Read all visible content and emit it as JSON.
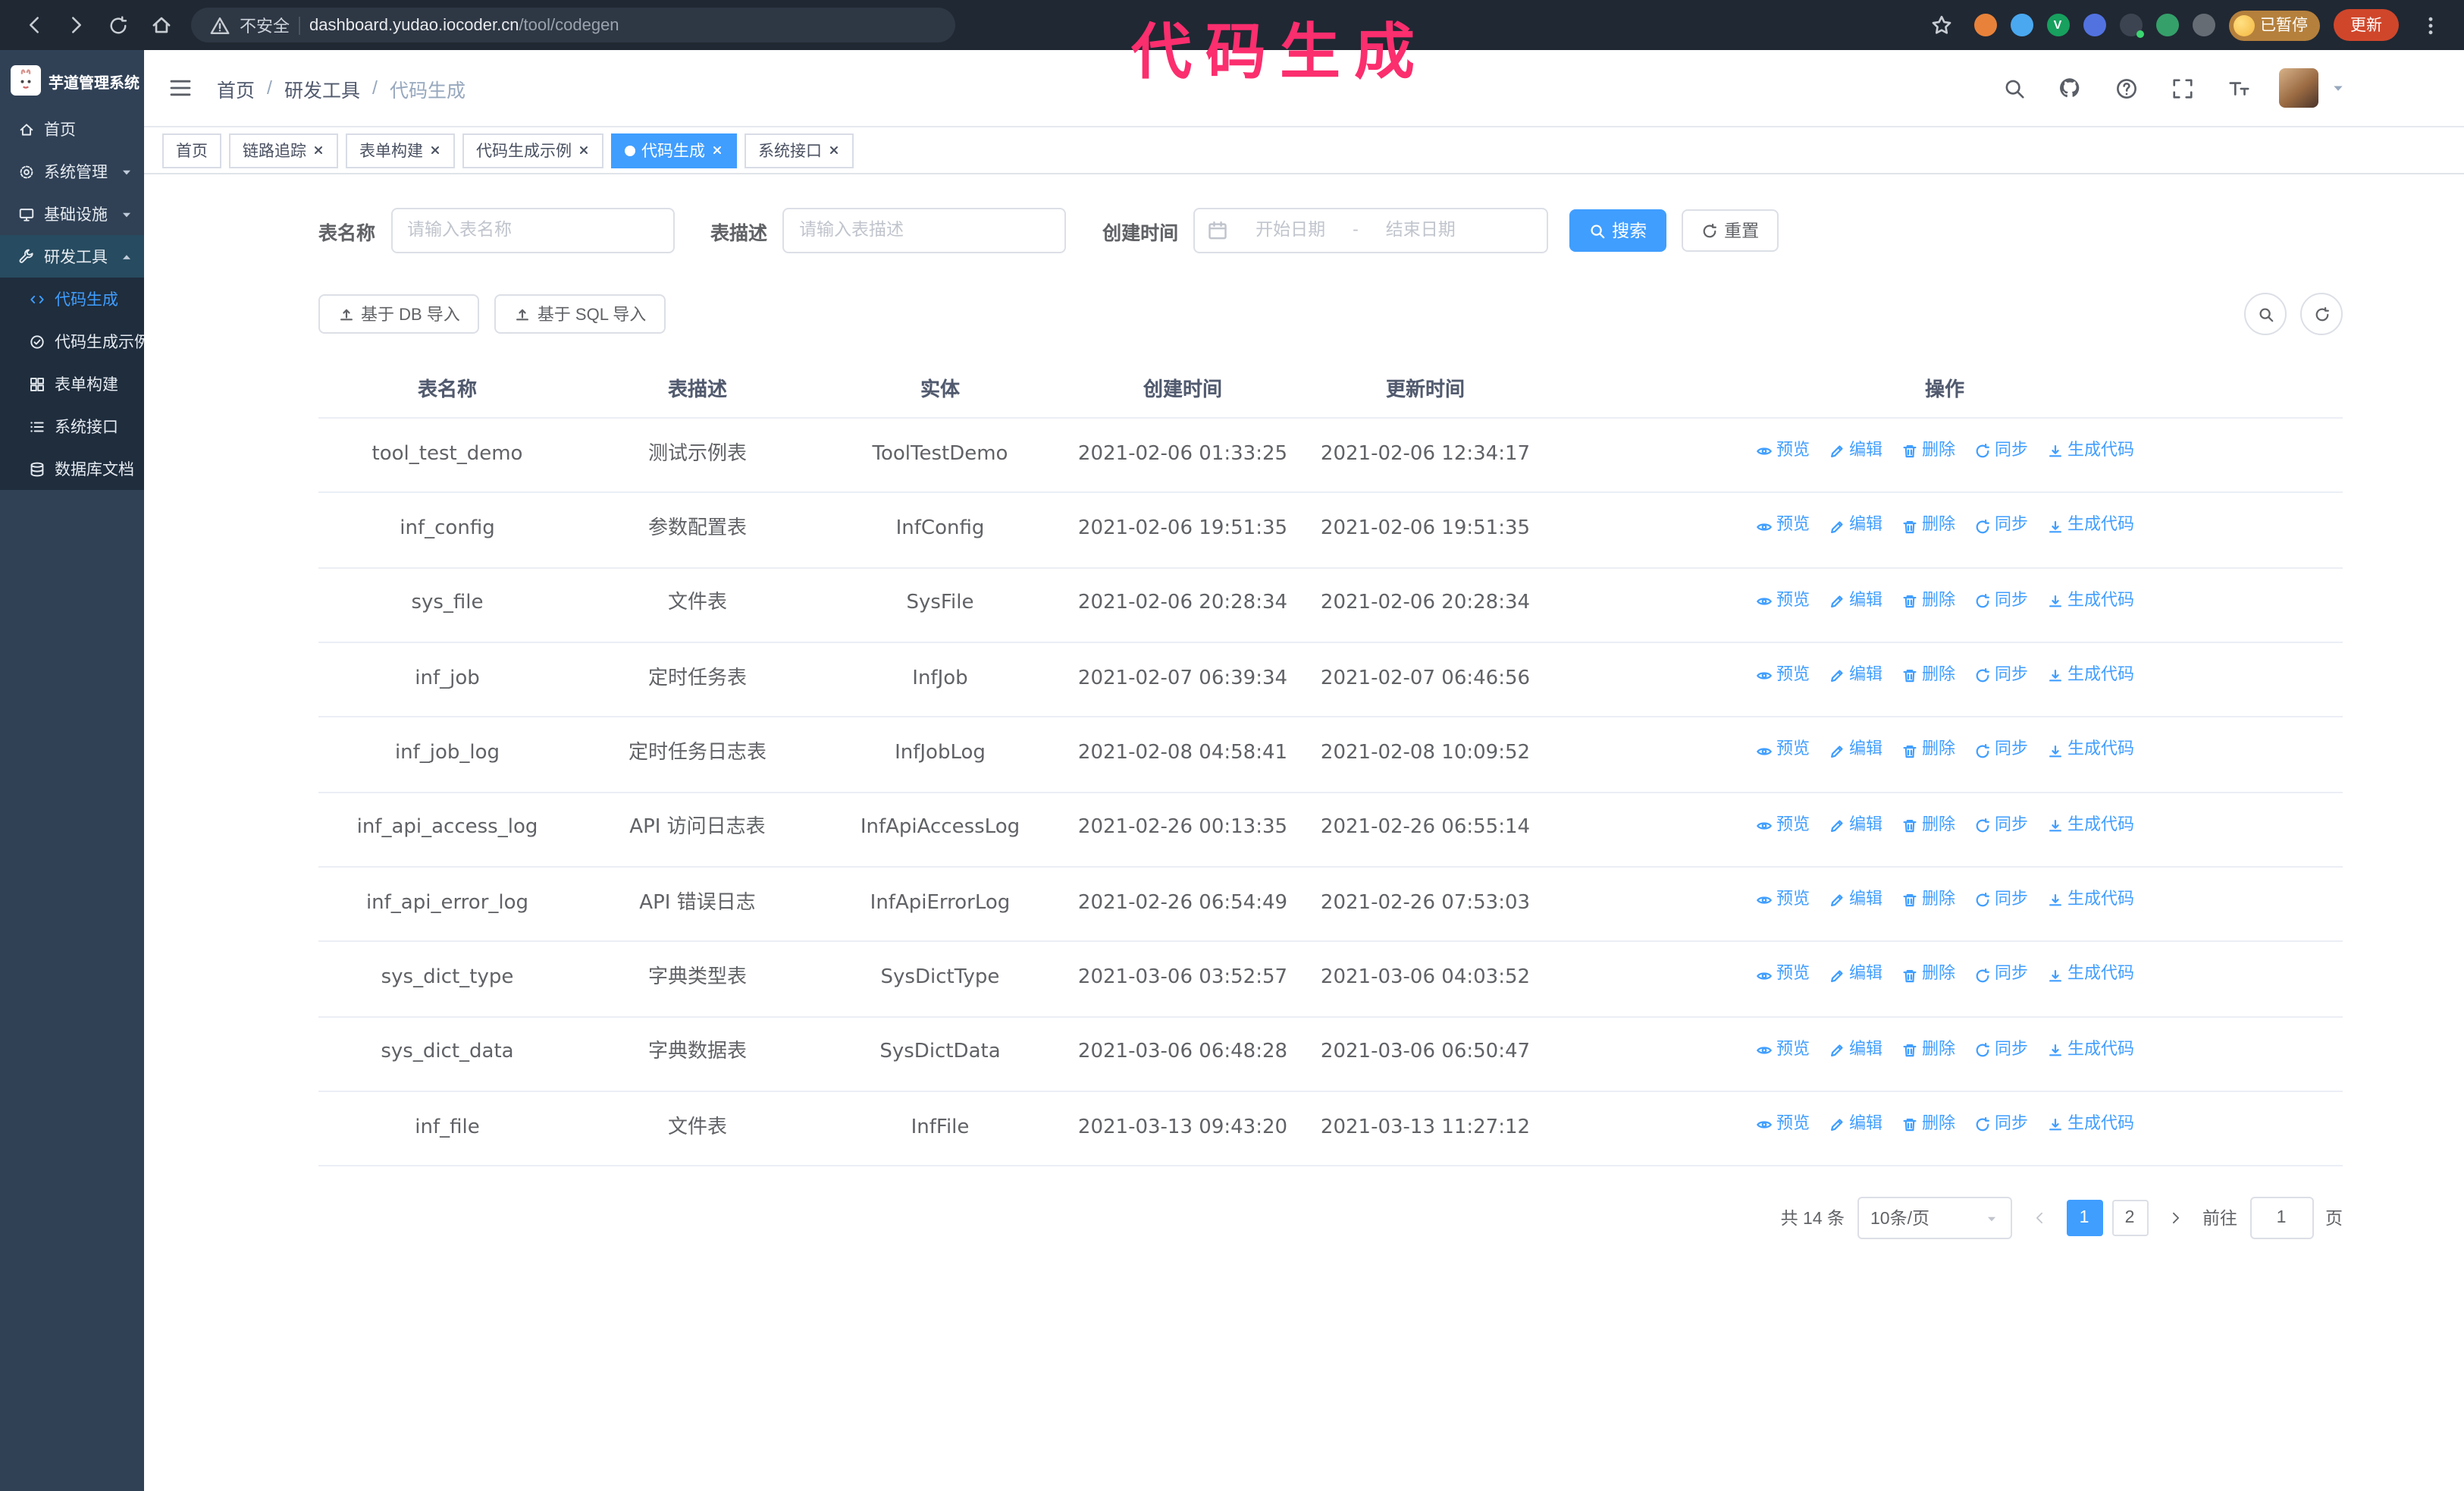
{
  "colors": {
    "accent": "#409eff",
    "sidebar_bg": "#304156",
    "submenu_bg": "#1f2d3d",
    "annotation": "#fb2e6e",
    "chrome_bg": "#202833"
  },
  "annotation": "代码生成",
  "browser": {
    "security_label": "不安全",
    "url_host": "dashboard.yudao.iocoder.cn",
    "url_path": "/tool/codegen",
    "paused_badge": "已暂停",
    "update_button": "更新"
  },
  "sidebar": {
    "logo_title": "芋道管理系统",
    "items": [
      {
        "id": "home",
        "icon": "home",
        "label": "首页"
      },
      {
        "id": "system",
        "icon": "gear",
        "label": "系统管理",
        "chevron": "down"
      },
      {
        "id": "infra",
        "icon": "monitor",
        "label": "基础设施",
        "chevron": "down"
      },
      {
        "id": "devtools",
        "icon": "tool",
        "label": "研发工具",
        "chevron": "up",
        "expanded": true,
        "children": [
          {
            "id": "codegen",
            "icon": "code",
            "label": "代码生成",
            "active": true
          },
          {
            "id": "codegen-demo",
            "icon": "badge",
            "label": "代码生成示例"
          },
          {
            "id": "form-builder",
            "icon": "grid",
            "label": "表单构建"
          },
          {
            "id": "api",
            "icon": "api",
            "label": "系统接口"
          },
          {
            "id": "db-doc",
            "icon": "db",
            "label": "数据库文档"
          }
        ]
      }
    ]
  },
  "header": {
    "breadcrumb": [
      "首页",
      "研发工具",
      "代码生成"
    ]
  },
  "tabs": [
    {
      "label": "首页",
      "closable": false,
      "active": false
    },
    {
      "label": "链路追踪",
      "closable": true,
      "active": false
    },
    {
      "label": "表单构建",
      "closable": true,
      "active": false
    },
    {
      "label": "代码生成示例",
      "closable": true,
      "active": false
    },
    {
      "label": "代码生成",
      "closable": true,
      "active": true
    },
    {
      "label": "系统接口",
      "closable": true,
      "active": false
    }
  ],
  "filters": {
    "table_name_label": "表名称",
    "table_name_placeholder": "请输入表名称",
    "table_desc_label": "表描述",
    "table_desc_placeholder": "请输入表描述",
    "create_time_label": "创建时间",
    "date_start_placeholder": "开始日期",
    "date_separator": "-",
    "date_end_placeholder": "结束日期",
    "search_button": "搜索",
    "reset_button": "重置"
  },
  "toolbar": {
    "import_db": "基于 DB 导入",
    "import_sql": "基于 SQL 导入"
  },
  "table": {
    "columns": [
      "表名称",
      "表描述",
      "实体",
      "创建时间",
      "更新时间",
      "操作"
    ],
    "actions": [
      "预览",
      "编辑",
      "删除",
      "同步",
      "生成代码"
    ],
    "rows": [
      {
        "name": "tool_test_demo",
        "desc": "测试示例表",
        "entity": "ToolTestDemo",
        "created": "2021-02-06 01:33:25",
        "updated": "2021-02-06 12:34:17"
      },
      {
        "name": "inf_config",
        "desc": "参数配置表",
        "entity": "InfConfig",
        "created": "2021-02-06 19:51:35",
        "updated": "2021-02-06 19:51:35"
      },
      {
        "name": "sys_file",
        "desc": "文件表",
        "entity": "SysFile",
        "created": "2021-02-06 20:28:34",
        "updated": "2021-02-06 20:28:34"
      },
      {
        "name": "inf_job",
        "desc": "定时任务表",
        "entity": "InfJob",
        "created": "2021-02-07 06:39:34",
        "updated": "2021-02-07 06:46:56"
      },
      {
        "name": "inf_job_log",
        "desc": "定时任务日志表",
        "entity": "InfJobLog",
        "created": "2021-02-08 04:58:41",
        "updated": "2021-02-08 10:09:52"
      },
      {
        "name": "inf_api_access_log",
        "desc": "API 访问日志表",
        "entity": "InfApiAccessLog",
        "created": "2021-02-26 00:13:35",
        "updated": "2021-02-26 06:55:14"
      },
      {
        "name": "inf_api_error_log",
        "desc": "API 错误日志",
        "entity": "InfApiErrorLog",
        "created": "2021-02-26 06:54:49",
        "updated": "2021-02-26 07:53:03"
      },
      {
        "name": "sys_dict_type",
        "desc": "字典类型表",
        "entity": "SysDictType",
        "created": "2021-03-06 03:52:57",
        "updated": "2021-03-06 04:03:52"
      },
      {
        "name": "sys_dict_data",
        "desc": "字典数据表",
        "entity": "SysDictData",
        "created": "2021-03-06 06:48:28",
        "updated": "2021-03-06 06:50:47"
      },
      {
        "name": "inf_file",
        "desc": "文件表",
        "entity": "InfFile",
        "created": "2021-03-13 09:43:20",
        "updated": "2021-03-13 11:27:12"
      }
    ]
  },
  "pagination": {
    "total": "共 14 条",
    "page_size": "10条/页",
    "pages": [
      "1",
      "2"
    ],
    "active_page": "1",
    "goto_label": "前往",
    "goto_value": "1",
    "goto_suffix": "页"
  }
}
